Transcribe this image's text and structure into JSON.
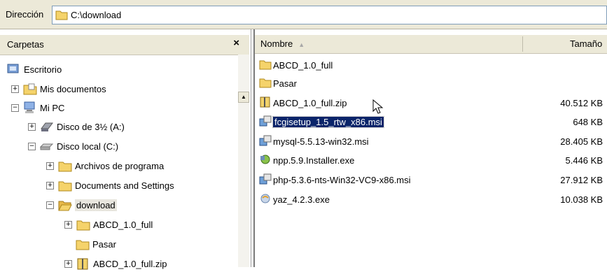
{
  "address": {
    "label": "Dirección",
    "path": "C:\\download"
  },
  "folders_pane": {
    "title": "Carpetas",
    "close": "×",
    "tree": [
      {
        "label": "Escritorio",
        "icon": "desktop-icon",
        "expander": ""
      },
      {
        "label": "Mis documentos",
        "icon": "folder-icon",
        "expander": "+"
      },
      {
        "label": "Mi PC",
        "icon": "computer-icon",
        "expander": "−"
      },
      {
        "label": "Disco de 3½ (A:)",
        "icon": "floppy-icon",
        "expander": "+"
      },
      {
        "label": "Disco local (C:)",
        "icon": "drive-icon",
        "expander": "−"
      },
      {
        "label": "Archivos de programa",
        "icon": "folder-icon",
        "expander": "+"
      },
      {
        "label": "Documents and Settings",
        "icon": "folder-icon",
        "expander": "+"
      },
      {
        "label": "download",
        "icon": "folder-open-icon",
        "expander": "−"
      },
      {
        "label": "ABCD_1.0_full",
        "icon": "folder-icon",
        "expander": "+"
      },
      {
        "label": "Pasar",
        "icon": "folder-icon",
        "expander": ""
      },
      {
        "label": "ABCD_1.0_full.zip",
        "icon": "zip-icon",
        "expander": "+"
      }
    ]
  },
  "file_list": {
    "columns": {
      "name": "Nombre",
      "size": "Tamaño"
    },
    "files": [
      {
        "name": "ABCD_1.0_full",
        "size": "",
        "icon": "folder-icon"
      },
      {
        "name": "Pasar",
        "size": "",
        "icon": "folder-icon"
      },
      {
        "name": "ABCD_1.0_full.zip",
        "size": "40.512 KB",
        "icon": "zip-icon"
      },
      {
        "name": "fcgisetup_1.5_rtw_x86.msi",
        "size": "648 KB",
        "icon": "msi-icon"
      },
      {
        "name": "mysql-5.5.13-win32.msi",
        "size": "28.405 KB",
        "icon": "msi-icon"
      },
      {
        "name": "npp.5.9.Installer.exe",
        "size": "5.446 KB",
        "icon": "installer-icon"
      },
      {
        "name": "php-5.3.6-nts-Win32-VC9-x86.msi",
        "size": "27.912 KB",
        "icon": "msi-icon"
      },
      {
        "name": "yaz_4.2.3.exe",
        "size": "10.038 KB",
        "icon": "exe-icon"
      }
    ]
  },
  "colors": {
    "selection": "#0a246a",
    "folder": "#f5d36b",
    "chrome": "#ece9d8"
  }
}
